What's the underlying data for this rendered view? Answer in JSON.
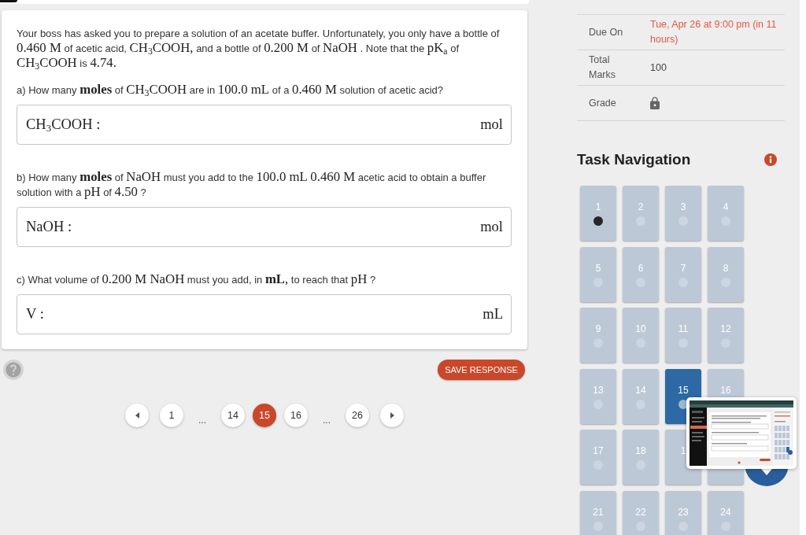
{
  "question": {
    "intro": [
      {
        "kind": "text",
        "text": "Your boss has asked you to prepare a solution of an acetate buffer. Unfortunately, you only have a bottle of "
      },
      {
        "kind": "math",
        "text": "0.460 M"
      },
      {
        "kind": "text",
        "text": " of acetic acid, "
      },
      {
        "kind": "math",
        "text": "CH$_{3}$COOH,"
      },
      {
        "kind": "text",
        "text": "  and a bottle of "
      },
      {
        "kind": "math",
        "text": "0.200 M"
      },
      {
        "kind": "text",
        "text": " of "
      },
      {
        "kind": "math",
        "text": "NaOH"
      },
      {
        "kind": "text",
        "text": " . Note that the "
      },
      {
        "kind": "math",
        "text": "pK$_{a}$"
      },
      {
        "kind": "text",
        "text": " of "
      },
      {
        "kind": "math",
        "text": "CH$_{3}$COOH"
      },
      {
        "kind": "text",
        "text": " is "
      },
      {
        "kind": "math",
        "text": "4.74."
      }
    ],
    "parts": [
      {
        "prompt": [
          {
            "kind": "text",
            "text": "a) How many "
          },
          {
            "kind": "math",
            "text": "**moles**"
          },
          {
            "kind": "text",
            "text": " of "
          },
          {
            "kind": "math",
            "text": "CH$_{3}$COOH"
          },
          {
            "kind": "text",
            "text": " are in "
          },
          {
            "kind": "math",
            "text": "100.0 mL"
          },
          {
            "kind": "text",
            "text": " of a "
          },
          {
            "kind": "math",
            "text": "0.460 M"
          },
          {
            "kind": "text",
            "text": " solution of acetic acid?"
          }
        ],
        "answer": {
          "prefix": "CH$_{3}$COOH :",
          "unit": "mol"
        }
      },
      {
        "prompt": [
          {
            "kind": "text",
            "text": "b) How many "
          },
          {
            "kind": "math",
            "text": "**moles**"
          },
          {
            "kind": "text",
            "text": " of "
          },
          {
            "kind": "math",
            "text": "NaOH"
          },
          {
            "kind": "text",
            "text": " must you add to the "
          },
          {
            "kind": "math",
            "text": "100.0 mL 0.460 M"
          },
          {
            "kind": "text",
            "text": " acetic acid to obtain a buffer solution with a "
          },
          {
            "kind": "math",
            "text": "pH"
          },
          {
            "kind": "text",
            "text": " of "
          },
          {
            "kind": "math",
            "text": "4.50"
          },
          {
            "kind": "text",
            "text": " ?"
          }
        ],
        "answer": {
          "prefix": "NaOH :",
          "unit": "mol"
        }
      },
      {
        "prompt": [
          {
            "kind": "text",
            "text": "c) What volume of "
          },
          {
            "kind": "math",
            "text": "0.200 M NaOH"
          },
          {
            "kind": "text",
            "text": " must you add, in "
          },
          {
            "kind": "math",
            "text": "**mL**,"
          },
          {
            "kind": "text",
            "text": " to reach that "
          },
          {
            "kind": "math",
            "text": "pH"
          },
          {
            "kind": "text",
            "text": " ?"
          }
        ],
        "answer": {
          "prefix": "V :",
          "unit": "mL"
        }
      }
    ]
  },
  "actions": {
    "save_label": "SAVE RESPONSE"
  },
  "pagination": {
    "items": [
      {
        "kind": "page",
        "label": "1",
        "selected": false
      },
      {
        "kind": "ellipsis",
        "label": "..."
      },
      {
        "kind": "page",
        "label": "14",
        "selected": false
      },
      {
        "kind": "page",
        "label": "15",
        "selected": true
      },
      {
        "kind": "page",
        "label": "16",
        "selected": false
      },
      {
        "kind": "ellipsis",
        "label": "..."
      },
      {
        "kind": "page",
        "label": "26",
        "selected": false
      }
    ]
  },
  "details": [
    {
      "kind": "due",
      "label": "Due On",
      "value": "Tue, Apr 26 at 9:00 pm (in 11 hours)"
    },
    {
      "kind": "text",
      "label": "Total Marks",
      "value": "100"
    },
    {
      "kind": "lock",
      "label": "Grade"
    }
  ],
  "task_navigation": {
    "title": "Task Navigation",
    "tiles": [
      {
        "label": "1",
        "selected": false,
        "answered": true
      },
      {
        "label": "2",
        "selected": false,
        "answered": false
      },
      {
        "label": "3",
        "selected": false,
        "answered": false
      },
      {
        "label": "4",
        "selected": false,
        "answered": false
      },
      {
        "label": "5",
        "selected": false,
        "answered": false
      },
      {
        "label": "6",
        "selected": false,
        "answered": false
      },
      {
        "label": "7",
        "selected": false,
        "answered": false
      },
      {
        "label": "8",
        "selected": false,
        "answered": false
      },
      {
        "label": "9",
        "selected": false,
        "answered": false
      },
      {
        "label": "10",
        "selected": false,
        "answered": false
      },
      {
        "label": "11",
        "selected": false,
        "answered": false
      },
      {
        "label": "12",
        "selected": false,
        "answered": false
      },
      {
        "label": "13",
        "selected": false,
        "answered": false
      },
      {
        "label": "14",
        "selected": false,
        "answered": false
      },
      {
        "label": "15",
        "selected": true,
        "answered": false
      },
      {
        "label": "16",
        "selected": false
      },
      {
        "label": "17",
        "selected": false,
        "answered": false
      },
      {
        "label": "18",
        "selected": false,
        "answered": false
      },
      {
        "label": "1",
        "selected": false
      },
      {
        "selected": false
      },
      {
        "label": "21",
        "selected": false,
        "answered": false
      },
      {
        "label": "22",
        "selected": false,
        "answered": false
      },
      {
        "label": "23",
        "selected": false,
        "answered": false
      },
      {
        "label": "24",
        "selected": false,
        "answered": false
      }
    ]
  }
}
